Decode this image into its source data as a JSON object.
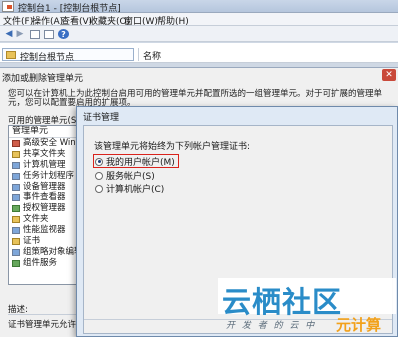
{
  "window": {
    "title": "控制台1 - [控制台根节点]"
  },
  "menu": [
    "文件(F)",
    "操作(A)",
    "查看(V)",
    "收藏夹(O)",
    "窗口(W)",
    "帮助(H)"
  ],
  "tree": {
    "root": "控制台根节点"
  },
  "results": {
    "name_column": "名称"
  },
  "snapin_dialog": {
    "title": "添加或删除管理单元",
    "close": "✕",
    "description": "您可以在计算机上为此控制台启用可用的管理单元并配置所选的一组管理单元。对于可扩展的管理单元，您可以配置要启用的扩展项。",
    "available_label": "可用的管理单元(S):",
    "list_header": "管理单元",
    "items": [
      "高级安全 Windows",
      "共享文件夹",
      "计算机管理",
      "任务计划程序",
      "设备管理器",
      "事件查看器",
      "授权管理器",
      "文件夹",
      "性能监视器",
      "证书",
      "组策略对象编辑器",
      "组件服务"
    ],
    "description_label": "描述:",
    "description_text": "证书管理单元允许您"
  },
  "cert_dialog": {
    "title": "证书管理",
    "prompt": "该管理单元将始终为下列帐户管理证书:",
    "options": [
      {
        "label": "我的用户帐户(M)",
        "selected": true
      },
      {
        "label": "服务帐户(S)",
        "selected": false
      },
      {
        "label": "计算机帐户(C)",
        "selected": false
      }
    ]
  },
  "watermark": {
    "main": "云栖社区",
    "sub": "开 发 者 的 云 中",
    "brand": "元计算"
  }
}
